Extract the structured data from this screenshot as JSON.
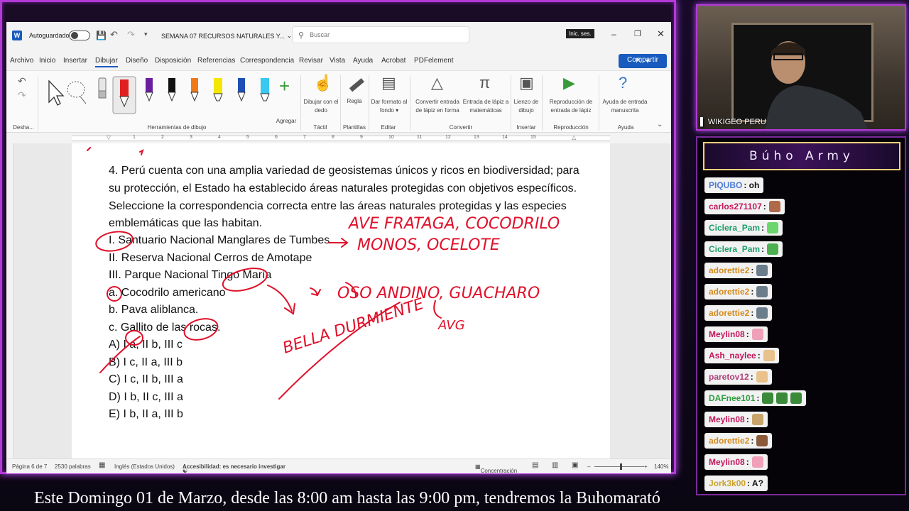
{
  "word": {
    "autosave_label": "Autoguardado",
    "doc_title": "SEMANA 07 RECURSOS NATURALES Y...",
    "search_placeholder": "Buscar",
    "signin_label": "Inic. ses.",
    "share_label": "Compartir",
    "menu": [
      "Archivo",
      "Inicio",
      "Insertar",
      "Dibujar",
      "Diseño",
      "Disposición",
      "Referencias",
      "Correspondencia",
      "Revisar",
      "Vista",
      "Ayuda",
      "Acrobat",
      "PDFelement"
    ],
    "ribbon": {
      "undo_label": "Desha...",
      "draw_tools_label": "Herramientas de dibujo",
      "add_label": "Agregar",
      "draw_finger": "Dibujar con el dedo",
      "tactil": "Táctil",
      "ruler": "Regla",
      "templates": "Plantillas",
      "format_bg": "Dar formato al fondo",
      "edit": "Editar",
      "convert_shape": "Convertir entrada de lápiz en forma",
      "math_input": "Entrada de lápiz a matemáticas",
      "convert": "Convertir",
      "canvas": "Lienzo de dibujo",
      "insert": "Insertar",
      "replay": "Reproducción de entrada de lápiz",
      "playback": "Reproducción",
      "handwrite_help": "Ayuda de entrada manuscrita",
      "help": "Ayuda"
    },
    "ruler_ticks": [
      "1",
      "2",
      "3",
      "4",
      "5",
      "6",
      "7",
      "8",
      "9",
      "10",
      "11",
      "12",
      "13",
      "14",
      "15"
    ],
    "document": {
      "question_lines": [
        "4. Perú cuenta con una amplia variedad de geosistemas únicos y ricos en biodiversidad; para",
        "su protección, el Estado ha establecido áreas naturales protegidas con objetivos específicos.",
        "Seleccione la correspondencia correcta entre las áreas naturales protegidas y las especies",
        "emblemáticas que las habitan."
      ],
      "items": [
        "I. Santuario Nacional Manglares de Tumbes",
        "II. Reserva Nacional Cerros de Amotape",
        "III. Parque Nacional Tingo María",
        "a. Cocodrilo americano",
        "b. Pava aliblanca.",
        "c. Gallito de las rocas.",
        "A) I a, II b, III c",
        "B) I c, II a, III b",
        "C) I c, II b, III a",
        "D) I b, II c, III a",
        "E) I b, II a, III b"
      ],
      "handwriting": [
        "AVE FRATAGA, COCODRILO",
        "MONOS, OCELOTE",
        "OSO ANDINO, GUACHARO",
        "BELLA DURMIENTE",
        "AVG"
      ]
    },
    "status": {
      "page": "Página 6 de 7",
      "words": "2530 palabras",
      "language": "Inglés (Estados Unidos)",
      "accessibility": "Accesibilidad: es necesario investigar",
      "focus": "Concentración",
      "zoom": "140%"
    }
  },
  "stream": {
    "cam_label": "WIKIGEO PERU",
    "chat_title": "Búho Army",
    "chat": [
      {
        "user": "PIQUBO",
        "color": "#4d7bd6",
        "msg": "oh",
        "emoji": ""
      },
      {
        "user": "carlos271107",
        "color": "#c2185b",
        "msg": "",
        "emoji": "#b06a4a"
      },
      {
        "user": "Ciclera_Pam",
        "color": "#1e9e6a",
        "msg": "",
        "emoji": "#6bd66b"
      },
      {
        "user": "Ciclera_Pam",
        "color": "#1e9e6a",
        "msg": "",
        "emoji": "#4caf50"
      },
      {
        "user": "adorettie2",
        "color": "#d48a1e",
        "msg": "",
        "emoji": "#6b7c8a"
      },
      {
        "user": "adorettie2",
        "color": "#d48a1e",
        "msg": "",
        "emoji": "#6b7c8a"
      },
      {
        "user": "adorettie2",
        "color": "#d48a1e",
        "msg": "",
        "emoji": "#6b7c8a"
      },
      {
        "user": "Meylin08",
        "color": "#c2185b",
        "msg": "",
        "emoji": "#f0a0b8"
      },
      {
        "user": "Ash_naylee",
        "color": "#c2185b",
        "msg": "",
        "emoji": "#e8c28a"
      },
      {
        "user": "paretov12",
        "color": "#b0407a",
        "msg": "",
        "emoji": "#e8c28a"
      },
      {
        "user": "DAFnee101",
        "color": "#2e9e3e",
        "msg": "",
        "emoji": "#3a8a3a"
      },
      {
        "user": "Meylin08",
        "color": "#c2185b",
        "msg": "",
        "emoji": "#c9a46a"
      },
      {
        "user": "adorettie2",
        "color": "#d48a1e",
        "msg": "",
        "emoji": "#8a5a3a"
      },
      {
        "user": "Meylin08",
        "color": "#c2185b",
        "msg": "",
        "emoji": "#f0a0b8"
      },
      {
        "user": "Jork3k00",
        "color": "#c9a22a",
        "msg": "A?",
        "emoji": ""
      }
    ],
    "ticker": "Este Domingo 01 de Marzo, desde las 8:00 am hasta las 9:00 pm, tendremos la Buhomarató"
  }
}
